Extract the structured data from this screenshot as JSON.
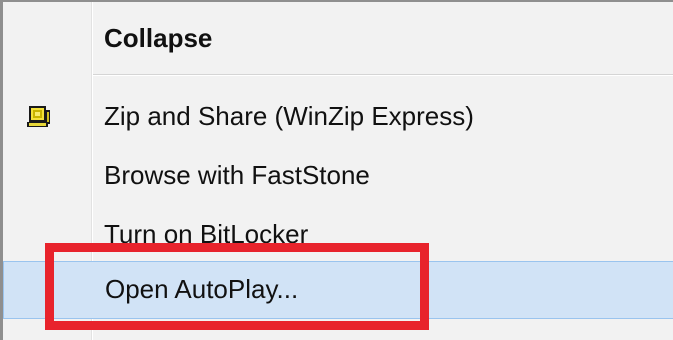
{
  "menu": {
    "items": [
      {
        "label": "Collapse",
        "bold": true,
        "icon": null
      },
      {
        "label": "Zip and Share (WinZip Express)",
        "icon": "winzip-express-icon"
      },
      {
        "label": "Browse with FastStone",
        "icon": null
      },
      {
        "label": "Turn on BitLocker",
        "icon": null
      },
      {
        "label": "Open AutoPlay...",
        "highlighted": true,
        "icon": null
      }
    ]
  },
  "colors": {
    "menu_background": "#f2f2f2",
    "highlight_background": "#d1e3f6",
    "highlight_border": "#9ac4ee",
    "annotation_red": "#e8232c"
  }
}
